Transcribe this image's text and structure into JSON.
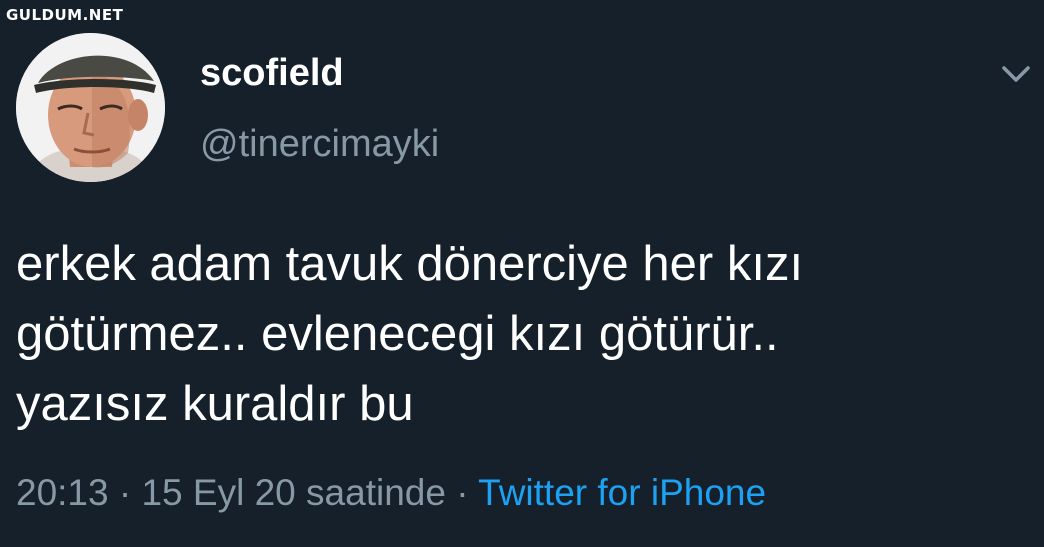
{
  "watermark": "GULDUM.NET",
  "user": {
    "display_name": "scofield",
    "handle": "@tinercimayki",
    "avatar_icon": "user-photo"
  },
  "tweet": {
    "lines": [
      "erkek adam tavuk dönerciye her kızı",
      "götürmez.. evlenecegi kızı götürür..",
      "yazısız kuraldır bu"
    ]
  },
  "meta": {
    "time": "20:13",
    "separator": "·",
    "date_text": "15 Eyl 20 saatinde",
    "source": "Twitter for iPhone"
  },
  "icons": {
    "menu": "chevron-down-icon"
  },
  "colors": {
    "background": "#15202b",
    "text": "#ffffff",
    "muted": "#8899a6",
    "link": "#1da1f2"
  }
}
